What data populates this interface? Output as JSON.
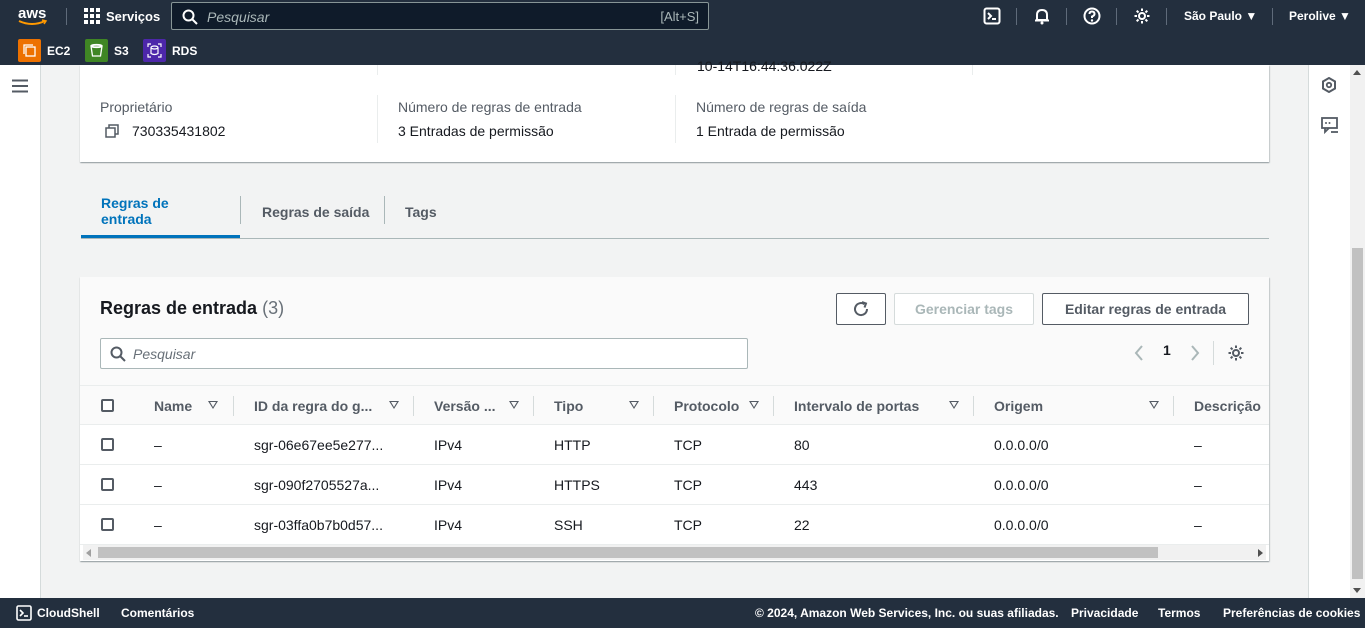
{
  "topnav": {
    "logo": "aws",
    "services_label": "Serviços",
    "search_placeholder": "Pesquisar",
    "search_shortcut": "[Alt+S]",
    "region": "São Paulo",
    "user": "Perolive"
  },
  "favorites": [
    {
      "label": "EC2",
      "color": "#ed7100",
      "icon": "ec2-icon"
    },
    {
      "label": "S3",
      "color": "#3f8624",
      "icon": "s3-icon"
    },
    {
      "label": "RDS",
      "color": "#4d27aa",
      "icon": "rds-icon"
    }
  ],
  "details": {
    "partial_value": "10-14T16:44:36.022Z",
    "owner_label": "Proprietário",
    "owner_value": "730335431802",
    "inbound_count_label": "Número de regras de entrada",
    "inbound_count_value": "3 Entradas de permissão",
    "outbound_count_label": "Número de regras de saída",
    "outbound_count_value": "1 Entrada de permissão"
  },
  "tabs": [
    {
      "label": "Regras de entrada",
      "active": true
    },
    {
      "label": "Regras de saída",
      "active": false
    },
    {
      "label": "Tags",
      "active": false
    }
  ],
  "table": {
    "title": "Regras de entrada",
    "count": "(3)",
    "manage_tags_label": "Gerenciar tags",
    "edit_rules_label": "Editar regras de entrada",
    "search_placeholder": "Pesquisar",
    "page": "1",
    "columns": [
      "Name",
      "ID da regra do g...",
      "Versão ...",
      "Tipo",
      "Protocolo",
      "Intervalo de portas",
      "Origem",
      "Descrição"
    ],
    "rows": [
      [
        "–",
        "sgr-06e67ee5e277...",
        "IPv4",
        "HTTP",
        "TCP",
        "80",
        "0.0.0.0/0",
        "–"
      ],
      [
        "–",
        "sgr-090f2705527a...",
        "IPv4",
        "HTTPS",
        "TCP",
        "443",
        "0.0.0.0/0",
        "–"
      ],
      [
        "–",
        "sgr-03ffa0b7b0d57...",
        "IPv4",
        "SSH",
        "TCP",
        "22",
        "0.0.0.0/0",
        "–"
      ]
    ]
  },
  "footer": {
    "cloudshell": "CloudShell",
    "feedback": "Comentários",
    "copyright": "© 2024, Amazon Web Services, Inc. ou suas afiliadas.",
    "privacy": "Privacidade",
    "terms": "Termos",
    "cookies": "Preferências de cookies"
  }
}
